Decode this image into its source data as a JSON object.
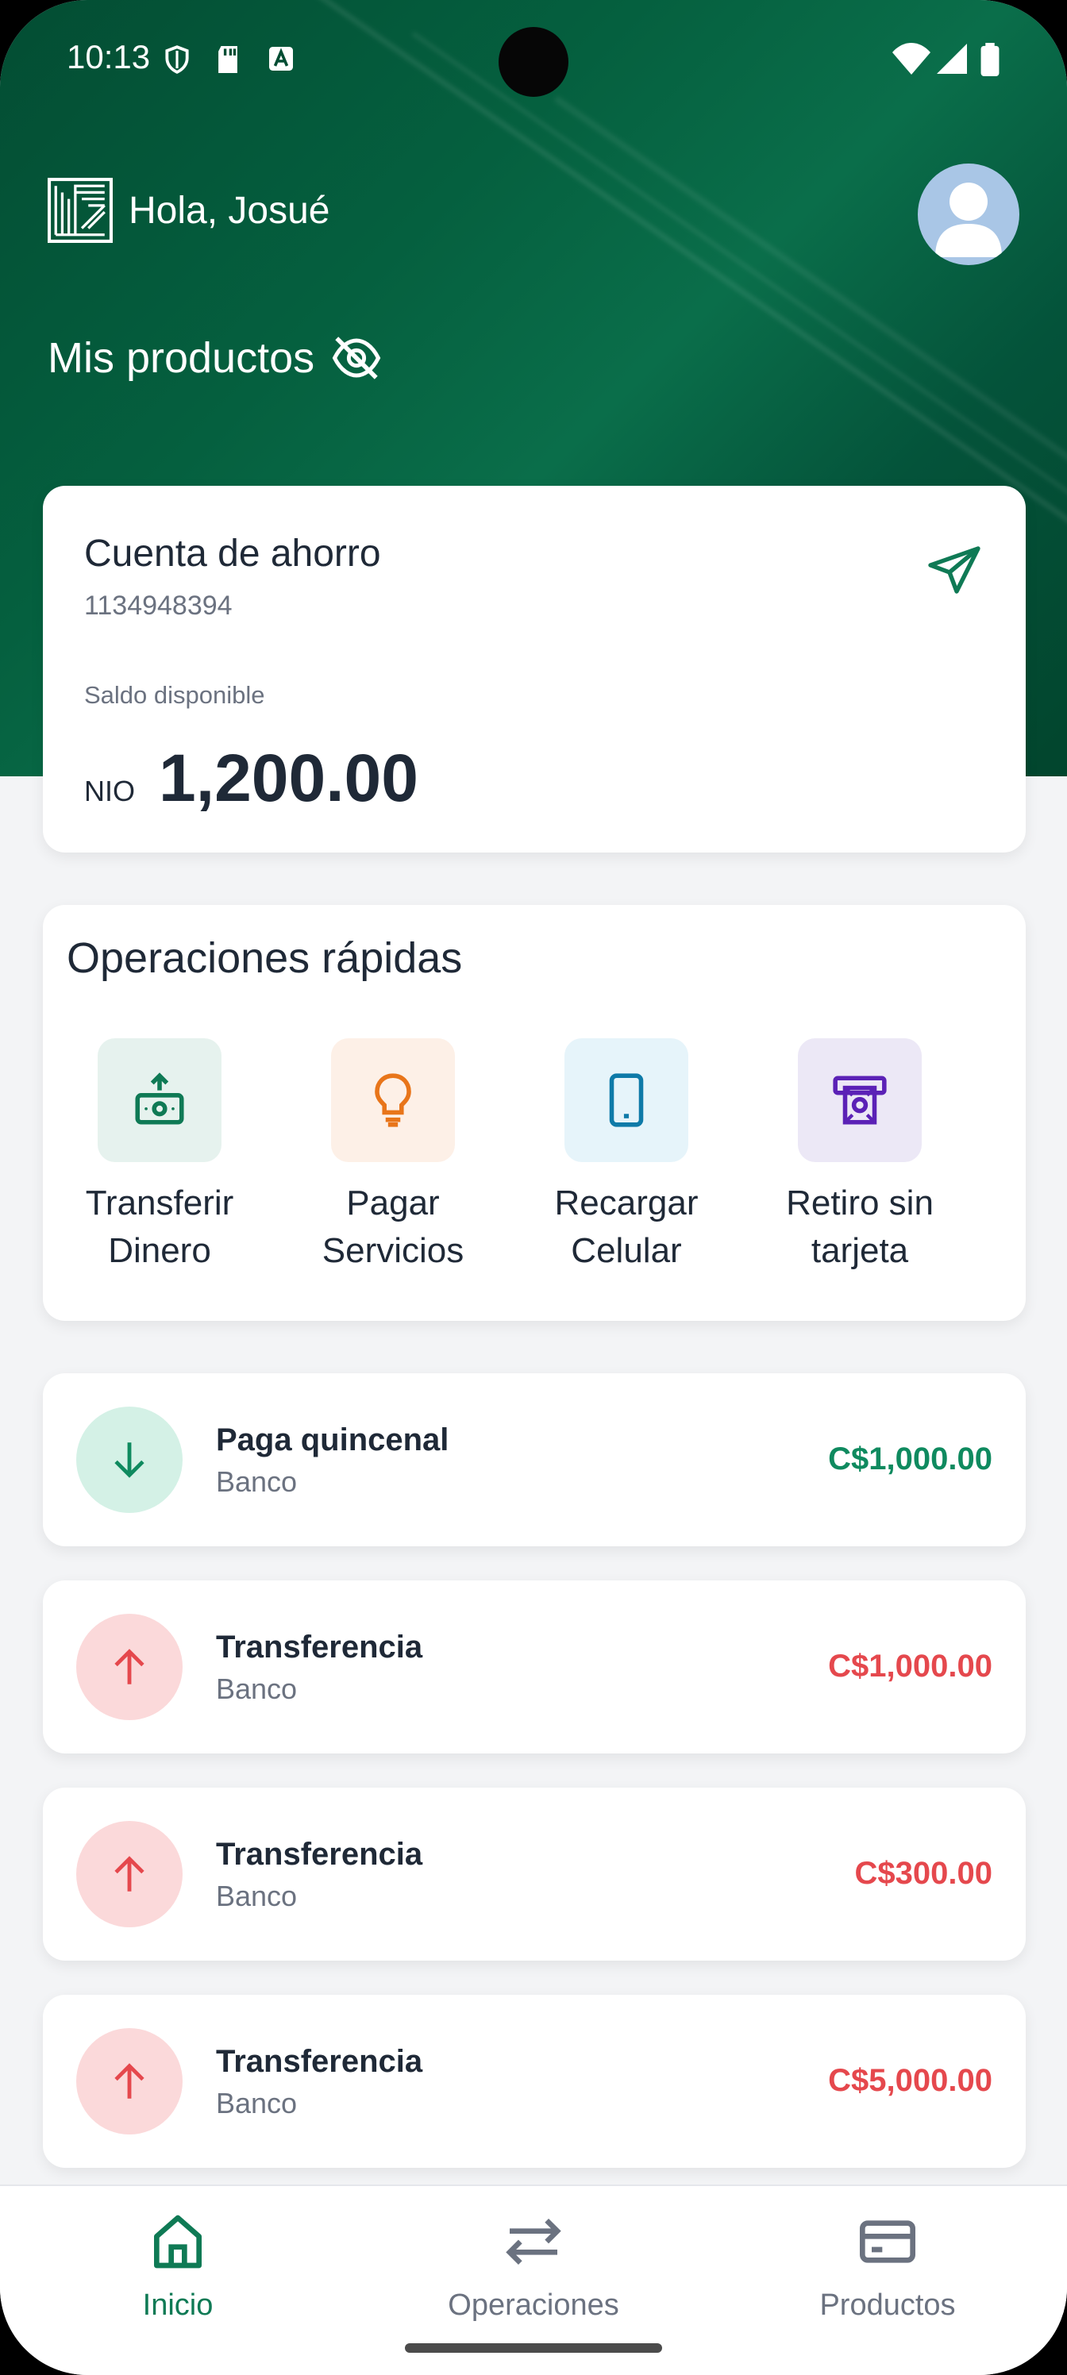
{
  "colors": {
    "brand_green": "#05603f",
    "income_green": "#0f8a5f",
    "expense_red": "#e5484d"
  },
  "status_bar": {
    "time": "10:13",
    "icons": [
      "shield-icon",
      "sd-card-icon",
      "a-notification-icon",
      "wifi-icon",
      "signal-icon",
      "battery-icon"
    ]
  },
  "header": {
    "greeting": "Hola, Josué",
    "logo_icon": "bank-logo-icon",
    "avatar_icon": "user-avatar-icon"
  },
  "products": {
    "title": "Mis productos",
    "visibility_icon": "eye-off-icon"
  },
  "account": {
    "name": "Cuenta de ahorro",
    "number": "1134948394",
    "balance_label": "Saldo disponible",
    "currency": "NIO",
    "balance": "1,200.00",
    "send_icon": "send-icon"
  },
  "quick_ops": {
    "title": "Operaciones rápidas",
    "items": [
      {
        "line1": "Transferir",
        "line2": "Dinero",
        "icon": "money-transfer-icon",
        "tile_color": "#e6f2ee",
        "icon_color": "#0f7a55"
      },
      {
        "line1": "Pagar",
        "line2": "Servicios",
        "icon": "lightbulb-icon",
        "tile_color": "#fdf0e7",
        "icon_color": "#e8751a"
      },
      {
        "line1": "Recargar",
        "line2": "Celular",
        "icon": "phone-icon",
        "tile_color": "#e6f4fa",
        "icon_color": "#0e7aa8"
      },
      {
        "line1": "Retiro sin",
        "line2": "tarjeta",
        "icon": "atm-icon",
        "tile_color": "#ece8f6",
        "icon_color": "#5b21b6"
      }
    ]
  },
  "transactions": [
    {
      "title": "Paga quincenal",
      "subtitle": "Banco",
      "amount": "C$1,000.00",
      "direction": "in",
      "icon": "arrow-down-icon"
    },
    {
      "title": "Transferencia",
      "subtitle": "Banco",
      "amount": "C$1,000.00",
      "direction": "out",
      "icon": "arrow-up-icon"
    },
    {
      "title": "Transferencia",
      "subtitle": "Banco",
      "amount": "C$300.00",
      "direction": "out",
      "icon": "arrow-up-icon"
    },
    {
      "title": "Transferencia",
      "subtitle": "Banco",
      "amount": "C$5,000.00",
      "direction": "out",
      "icon": "arrow-up-icon"
    }
  ],
  "bottom_nav": {
    "items": [
      {
        "label": "Inicio",
        "icon": "home-icon",
        "active": true
      },
      {
        "label": "Operaciones",
        "icon": "swap-arrows-icon",
        "active": false
      },
      {
        "label": "Productos",
        "icon": "card-icon",
        "active": false
      }
    ]
  }
}
